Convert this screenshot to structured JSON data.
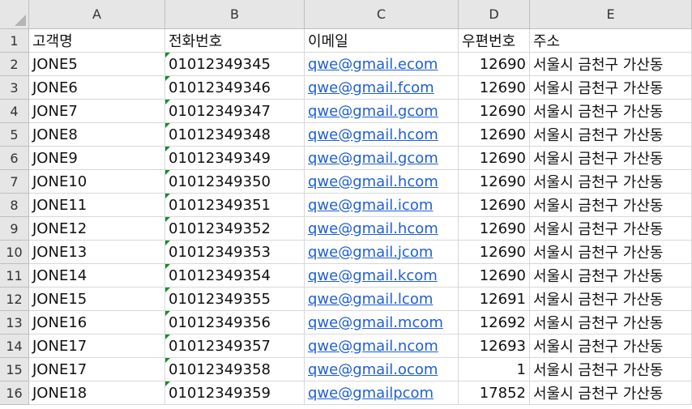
{
  "columns": [
    "A",
    "B",
    "C",
    "D",
    "E"
  ],
  "rows": [
    {
      "num": "1",
      "cells": [
        "고객명",
        "전화번호",
        "이메일",
        "우편번호",
        "주소"
      ]
    },
    {
      "num": "2",
      "cells": [
        "JONE5",
        "01012349345",
        "qwe@gmail.ecom",
        "12690",
        "서울시 금천구 가산동"
      ]
    },
    {
      "num": "3",
      "cells": [
        "JONE6",
        "01012349346",
        "qwe@gmail.fcom",
        "12690",
        "서울시 금천구 가산동"
      ]
    },
    {
      "num": "4",
      "cells": [
        "JONE7",
        "01012349347",
        "qwe@gmail.gcom",
        "12690",
        "서울시 금천구 가산동"
      ]
    },
    {
      "num": "5",
      "cells": [
        "JONE8",
        "01012349348",
        "qwe@gmail.hcom",
        "12690",
        "서울시 금천구 가산동"
      ]
    },
    {
      "num": "6",
      "cells": [
        "JONE9",
        "01012349349",
        "qwe@gmail.gcom",
        "12690",
        "서울시 금천구 가산동"
      ]
    },
    {
      "num": "7",
      "cells": [
        "JONE10",
        "01012349350",
        "qwe@gmail.hcom",
        "12690",
        "서울시 금천구 가산동"
      ]
    },
    {
      "num": "8",
      "cells": [
        "JONE11",
        "01012349351",
        "qwe@gmail.icom",
        "12690",
        "서울시 금천구 가산동"
      ]
    },
    {
      "num": "9",
      "cells": [
        "JONE12",
        "01012349352",
        "qwe@gmail.hcom",
        "12690",
        "서울시 금천구 가산동"
      ]
    },
    {
      "num": "10",
      "cells": [
        "JONE13",
        "01012349353",
        "qwe@gmail.jcom",
        "12690",
        "서울시 금천구 가산동"
      ]
    },
    {
      "num": "11",
      "cells": [
        "JONE14",
        "01012349354",
        "qwe@gmail.kcom",
        "12690",
        "서울시 금천구 가산동"
      ]
    },
    {
      "num": "12",
      "cells": [
        "JONE15",
        "01012349355",
        "qwe@gmail.lcom",
        "12691",
        "서울시 금천구 가산동"
      ]
    },
    {
      "num": "13",
      "cells": [
        "JONE16",
        "01012349356",
        "qwe@gmail.mcom",
        "12692",
        "서울시 금천구 가산동"
      ]
    },
    {
      "num": "14",
      "cells": [
        "JONE17",
        "01012349357",
        "qwe@gmail.ncom",
        "12693",
        "서울시 금천구 가산동"
      ]
    },
    {
      "num": "15",
      "cells": [
        "JONE17",
        "01012349358",
        "qwe@gmail.ocom",
        "1",
        "서울시 금천구 가산동"
      ]
    },
    {
      "num": "16",
      "cells": [
        "JONE18",
        "01012349359",
        "qwe@gmailpcom",
        "17852",
        "서울시 금천구 가산동"
      ]
    }
  ],
  "colors": {
    "header_bg": "#e6e6e6",
    "link": "#1f5fd6",
    "error_flag": "#168b2c",
    "gridline": "#d8d8d8"
  }
}
